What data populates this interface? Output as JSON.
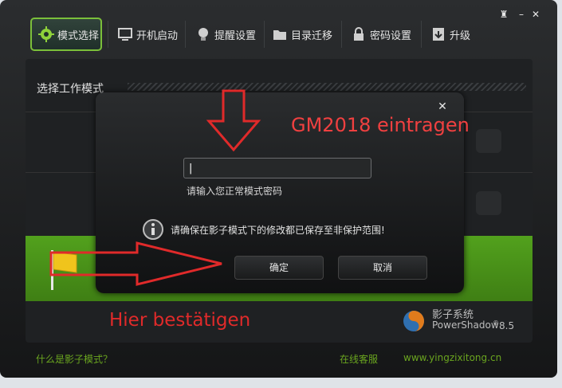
{
  "window": {
    "controls": {
      "skin": "♜",
      "minimize": "–",
      "close": "✕"
    }
  },
  "toolbar": {
    "tabs": [
      {
        "label": "模式选择",
        "icon": "gear-icon",
        "active": true
      },
      {
        "label": "开机启动",
        "icon": "monitor-icon"
      },
      {
        "label": "提醒设置",
        "icon": "bulb-icon"
      },
      {
        "label": "目录迁移",
        "icon": "folder-icon"
      },
      {
        "label": "密码设置",
        "icon": "lock-icon"
      },
      {
        "label": "升级",
        "icon": "upgrade-icon"
      }
    ]
  },
  "main": {
    "section_title": "选择工作模式"
  },
  "brand": {
    "name": "影子系统",
    "product": "PowerShadow",
    "version": "8.5",
    "registered": "®"
  },
  "footer": {
    "help_link": "什么是影子模式？",
    "support_link": "在线客服",
    "website": "www.yingzixitong.cn"
  },
  "dialog": {
    "close": "✕",
    "password_value": "|",
    "password_hint": "请输入您正常模式密码",
    "info_message": "请确保在影子模式下的修改都已保存至非保护范围!",
    "ok_label": "确定",
    "cancel_label": "取消"
  },
  "annotations": {
    "top_text": "GM2018 eintragen",
    "bottom_text": "Hier bestätigen",
    "color": "#e02a2a"
  },
  "colors": {
    "accent_green": "#6aa51f",
    "band_green": "#52a11d",
    "background": "#1f2123"
  }
}
